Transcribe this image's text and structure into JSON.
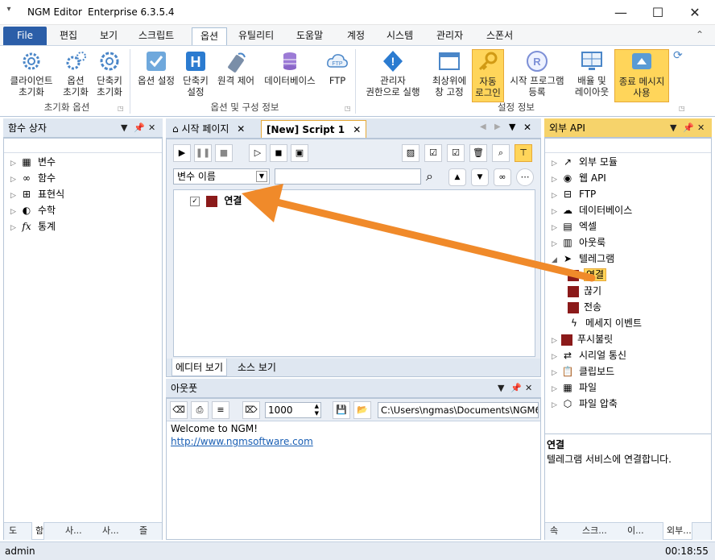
{
  "window": {
    "title": "NGM Editor",
    "edition": "Enterprise 6.3.5.4",
    "sysmenu_glyph": "▾",
    "controls": {
      "minimize": "—",
      "maximize": "☐",
      "close": "✕"
    }
  },
  "menu": {
    "tabs": [
      "File",
      "편집",
      "보기",
      "스크립트",
      "옵션",
      "유틸리티",
      "도움말",
      "계정",
      "시스템",
      "관리자",
      "스폰서"
    ],
    "active": "옵션"
  },
  "ribbon": {
    "groups": {
      "reset": "초기화 옵션",
      "options": "옵션 및 구성 정보",
      "settings": "설정 정보"
    },
    "buttons": {
      "client_reset_1": "클라이언트",
      "client_reset_2": "초기화",
      "option_reset_1": "옵션",
      "option_reset_2": "초기화",
      "shortcut_reset_1": "단축키",
      "shortcut_reset_2": "초기화",
      "option_settings": "옵션 설정",
      "shortcut_settings_1": "단축키",
      "shortcut_settings_2": "설정",
      "remote_control": "원격 제어",
      "database": "데이터베이스",
      "ftp": "FTP",
      "run_admin_1": "관리자",
      "run_admin_2": "권한으로 실행",
      "topmost_1": "최상위에",
      "topmost_2": "창 고정",
      "auto_login_1": "자동",
      "auto_login_2": "로그인",
      "startup_1": "시작 프로그램",
      "startup_2": "등록",
      "layout_1": "배율 및",
      "layout_2": "레이아웃",
      "exit_msg_1": "종료 메시지",
      "exit_msg_2": "사용"
    }
  },
  "left_panel": {
    "title": "함수 상자",
    "items": [
      {
        "label": "변수",
        "icon": "variable-icon"
      },
      {
        "label": "함수",
        "icon": "function-icon"
      },
      {
        "label": "표현식",
        "icon": "expression-icon"
      },
      {
        "label": "수학",
        "icon": "math-icon"
      },
      {
        "label": "통계",
        "icon": "statistics-icon"
      }
    ],
    "bottom_tabs": [
      "도",
      "함",
      "사...",
      "사...",
      "즐"
    ]
  },
  "doc_tabs": {
    "start": "시작 페이지",
    "script": "[New] Script 1"
  },
  "editor": {
    "variable_select": "변수 이름",
    "search_value": "",
    "tree_item": "연결",
    "view_tabs": [
      "에디터 보기",
      "소스 보기"
    ]
  },
  "output": {
    "title": "아웃풋",
    "count": "1000",
    "path": "C:\\Users\\ngmas\\Documents\\NGM6\\",
    "line1": "Welcome to NGM!",
    "link": "http://www.ngmsoftware.com"
  },
  "right_panel": {
    "title": "외부 API",
    "items": [
      {
        "label": "외부 모듈",
        "icon": "external-link-icon",
        "level": 0
      },
      {
        "label": "웹 API",
        "icon": "globe-icon",
        "level": 0
      },
      {
        "label": "FTP",
        "icon": "ftp-icon",
        "level": 0
      },
      {
        "label": "데이터베이스",
        "icon": "database-icon",
        "level": 0
      },
      {
        "label": "엑셀",
        "icon": "excel-icon",
        "level": 0
      },
      {
        "label": "아웃룩",
        "icon": "outlook-icon",
        "level": 0
      },
      {
        "label": "텔레그램",
        "icon": "telegram-icon",
        "level": 0,
        "expanded": true
      },
      {
        "label": "연결",
        "icon": "connect-icon",
        "level": 1,
        "selected": true
      },
      {
        "label": "끊기",
        "icon": "disconnect-icon",
        "level": 1
      },
      {
        "label": "전송",
        "icon": "send-icon",
        "level": 1
      },
      {
        "label": "메세지 이벤트",
        "icon": "lightning-icon",
        "level": 1
      },
      {
        "label": "푸시불릿",
        "icon": "pushbullet-icon",
        "level": 0
      },
      {
        "label": "시리얼 통신",
        "icon": "serial-icon",
        "level": 0
      },
      {
        "label": "클립보드",
        "icon": "clipboard-icon",
        "level": 0
      },
      {
        "label": "파일",
        "icon": "file-icon",
        "level": 0
      },
      {
        "label": "파일 압축",
        "icon": "zip-icon",
        "level": 0
      }
    ],
    "desc_title": "연결",
    "desc_text": "텔레그램 서비스에 연결합니다.",
    "bottom_tabs": [
      "속",
      "스크...",
      "이...",
      "외부..."
    ]
  },
  "status": {
    "user": "admin",
    "time": "00:18:55"
  },
  "colors": {
    "accent": "#2b5ea8",
    "arrow": "#f08a2a",
    "highlight": "#ffd55a"
  }
}
